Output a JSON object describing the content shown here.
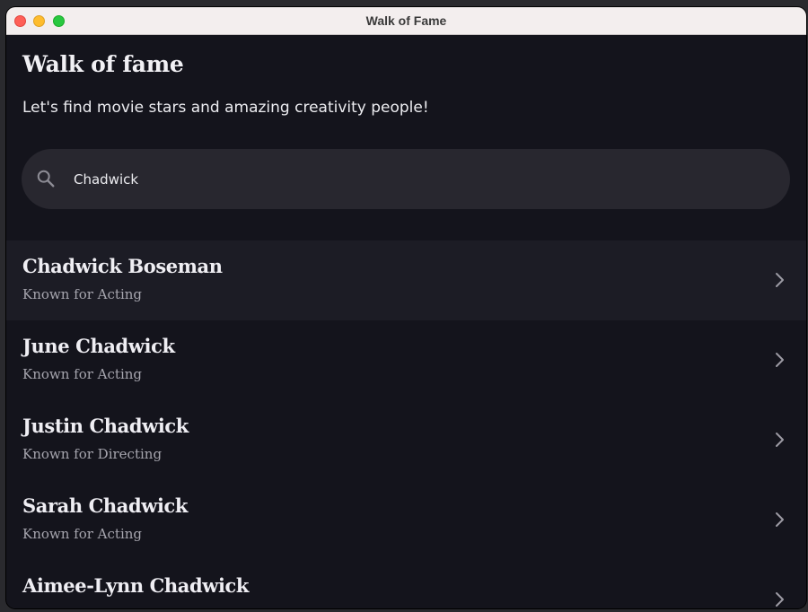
{
  "window": {
    "title": "Walk of Fame"
  },
  "header": {
    "title": "Walk of fame",
    "subtitle": "Let's find movie stars and amazing creativity people!"
  },
  "search": {
    "value": "Chadwick",
    "icon": "search-icon"
  },
  "results": [
    {
      "name": "Chadwick Boseman",
      "known_for": "Known for Acting",
      "highlighted": true
    },
    {
      "name": "June Chadwick",
      "known_for": "Known for Acting",
      "highlighted": false
    },
    {
      "name": "Justin Chadwick",
      "known_for": "Known for Directing",
      "highlighted": false
    },
    {
      "name": "Sarah Chadwick",
      "known_for": "Known for Acting",
      "highlighted": false
    },
    {
      "name": "Aimee-Lynn Chadwick",
      "known_for": "",
      "highlighted": false
    }
  ],
  "colors": {
    "background": "#14141c",
    "highlight_row": "#1c1c25",
    "search_box": "#28272f",
    "text_primary": "#efeef3",
    "text_secondary": "#a6a5ae"
  }
}
